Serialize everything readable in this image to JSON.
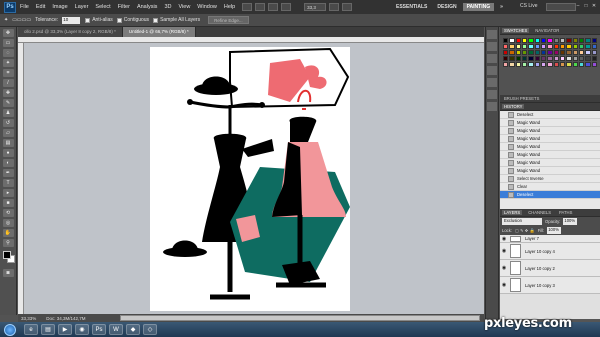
{
  "menu": {
    "logo": "Ps",
    "items": [
      "File",
      "Edit",
      "Image",
      "Layer",
      "Select",
      "Filter",
      "Analysis",
      "3D",
      "View",
      "Window",
      "Help"
    ],
    "zoom": "33,3"
  },
  "workspaces": {
    "essentials": "ESSENTIALS",
    "design": "DESIGN",
    "painting": "PAINTING",
    "more": "»"
  },
  "cslive": "CS Live",
  "options": {
    "tolerance_label": "Tolerance:",
    "tolerance_value": "10",
    "antialias": "Anti-alias",
    "contiguous": "Contiguous",
    "sample_all": "Sample All Layers",
    "refine_edge": "Refine Edge..."
  },
  "tabs": [
    {
      "label": "ollo 2.psd @ 33,3% (Layer 8 copy 2, RGB/8) *",
      "active": false
    },
    {
      "label": "Untitled-1 @ 66,7% (RGB/8) *",
      "active": true
    }
  ],
  "status": {
    "zoom": "33,33%",
    "doc": "Doc: 34,3M/142,7M"
  },
  "panels": {
    "swatches_tab": "SWATCHES",
    "navigator_tab": "NAVIGATOR",
    "brush_presets": "BRUSH PRESETS",
    "history_tab": "HISTORY",
    "layers_tab": "LAYERS",
    "channels_tab": "CHANNELS",
    "paths_tab": "PATHS"
  },
  "history": [
    {
      "label": "Deselect",
      "active": false
    },
    {
      "label": "Magic Wand",
      "active": false
    },
    {
      "label": "Magic Wand",
      "active": false
    },
    {
      "label": "Magic Wand",
      "active": false
    },
    {
      "label": "Magic Wand",
      "active": false
    },
    {
      "label": "Magic Wand",
      "active": false
    },
    {
      "label": "Magic Wand",
      "active": false
    },
    {
      "label": "Magic Wand",
      "active": false
    },
    {
      "label": "Select Inverse",
      "active": false
    },
    {
      "label": "Clear",
      "active": false
    },
    {
      "label": "Deselect",
      "active": true
    }
  ],
  "layers": {
    "blend_mode": "Exclusion",
    "opacity_label": "Opacity:",
    "opacity": "100%",
    "lock_label": "Lock:",
    "fill_label": "Fill:",
    "fill": "100%",
    "items": [
      {
        "label": "Layer 7"
      },
      {
        "label": "Layer 10 copy 4"
      },
      {
        "label": "Layer 10 copy 2"
      },
      {
        "label": "Layer 10 copy 3"
      }
    ]
  },
  "swatch_colors": [
    "#000000",
    "#ffffff",
    "#ff0000",
    "#ffff00",
    "#00ff00",
    "#00ffff",
    "#0000ff",
    "#ff00ff",
    "#808080",
    "#c0c0c0",
    "#800000",
    "#808000",
    "#008000",
    "#008080",
    "#000080",
    "#ff6666",
    "#ffcc66",
    "#ffff99",
    "#99ff99",
    "#66ffff",
    "#6699ff",
    "#cc99ff",
    "#ff99cc",
    "#ff3300",
    "#ff9900",
    "#ffcc00",
    "#99cc00",
    "#33cc66",
    "#009999",
    "#3366cc",
    "#cc0000",
    "#cc6600",
    "#cccc00",
    "#669900",
    "#006633",
    "#006666",
    "#003399",
    "#660099",
    "#990066",
    "#663300",
    "#996633",
    "#cc9966",
    "#ffcc99",
    "#ccccff",
    "#9999cc",
    "#330000",
    "#333300",
    "#003300",
    "#003333",
    "#000033",
    "#330033",
    "#663366",
    "#996699",
    "#cc99cc",
    "#ffccff",
    "#e0e0e0",
    "#a0a0a0",
    "#606060",
    "#404040",
    "#202020",
    "#f2a6a6",
    "#f2d6a6",
    "#f2f2a6",
    "#a6f2a6",
    "#a6f2f2",
    "#a6a6f2",
    "#d6a6f2",
    "#f2a6d6",
    "#d94d4d",
    "#d9964d",
    "#d9d94d",
    "#4dd94d",
    "#4dd9d9",
    "#4d4dd9",
    "#964dd9"
  ],
  "watermark": "pxleyes.com"
}
